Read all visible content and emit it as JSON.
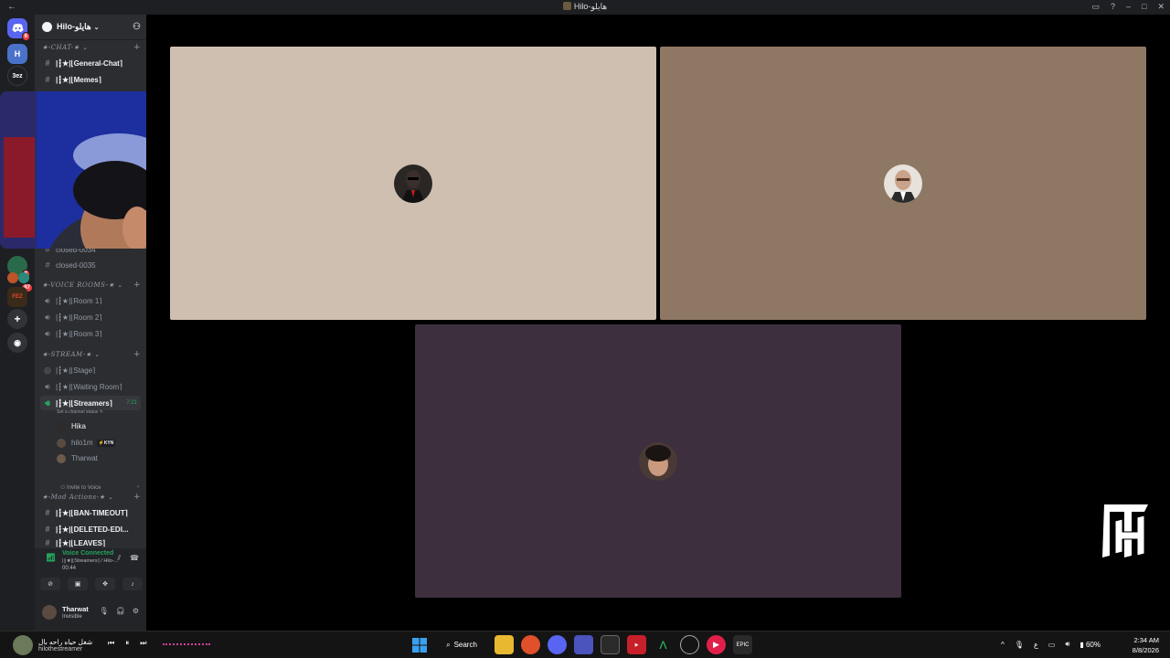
{
  "window": {
    "title": "Hilo-هايلو"
  },
  "server": {
    "name": "Hilo-هايلو",
    "categories": {
      "chat": "★-CHAT-★",
      "voice": "★-VOICE ROOMS-★",
      "stream": "★-STREAM-★",
      "mod": "★-Mod Actions-★"
    },
    "channels": {
      "general": "|┇★|⌊General-Chat⌉",
      "memes": "|┇★|⌊Memes⌉",
      "closed34": "closed-0034",
      "closed35": "closed-0035",
      "room1": "|┇★|⌊Room 1⌉",
      "room2": "|┇★|⌊Room 2⌉",
      "room3": "|┇★|⌊Room 3⌉",
      "stage": "|┇★|⌊Stage⌉",
      "waiting": "|┇★|⌊Waiting Room⌉",
      "streamers": "|┇★|⌊Streamers⌉",
      "ban": "|┇★|⌊BAN-TIMEOUT⌉",
      "deleted": "|┇★|⌊DELETED-EDI...",
      "leaves": "|┇★|⌊LEAVES⌉"
    },
    "streamers_timer": "7:21",
    "status_hint": "Set a channel status",
    "members": [
      {
        "name": "Hika",
        "color": "#2f2a28"
      },
      {
        "name": "hilo1m",
        "color": "#5a4a40",
        "tag": "KYN"
      },
      {
        "name": "Tharwat",
        "color": "#6b5a4c"
      }
    ],
    "invite": "Invite to Voice"
  },
  "rail": {
    "badges": {
      "top": "6",
      "mid1": "8",
      "mid2": "87"
    },
    "label_3ez": "3ez"
  },
  "voice": {
    "status": "Voice Connected",
    "path": "|┇★|⌊Streamers⌉ / Hilo-...",
    "elapsed": "00:44"
  },
  "user": {
    "name": "Tharwat",
    "status": "Invisible"
  },
  "tiles": [
    {
      "bg": "#cfbfb0",
      "av": "#2a2624"
    },
    {
      "bg": "#8e7864",
      "av": "#e8e2dc"
    },
    {
      "bg": "#3d2f3e",
      "av": "#4a3a36"
    }
  ],
  "taskbar": {
    "media_title": "شغل حياه راحه بال",
    "media_sub": "hilothestreamer",
    "search": "Search",
    "battery": "60%",
    "lang": "ع",
    "time": "2:34 AM",
    "date": "8/8/2026"
  },
  "colors": {
    "accent_green": "#23a55a",
    "sidebar": "#2b2d31",
    "rail": "#1e1f22"
  }
}
